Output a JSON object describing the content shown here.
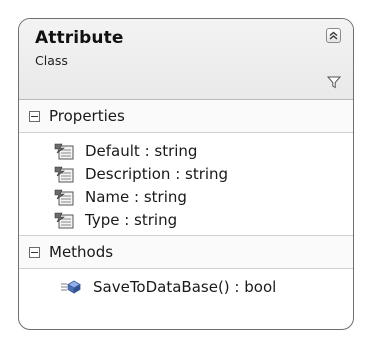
{
  "class_shape": {
    "name": "Attribute",
    "stereotype": "Class",
    "icons": {
      "collapse": "double-chevron-up-icon",
      "filter": "filter-icon"
    }
  },
  "sections": {
    "properties": {
      "label": "Properties",
      "icon": "property-icon",
      "items": [
        "Default : string",
        "Description : string",
        "Name : string",
        "Type : string"
      ]
    },
    "methods": {
      "label": "Methods",
      "icon": "method-icon",
      "items": [
        "SaveToDataBase() : bool"
      ]
    }
  },
  "colors": {
    "border": "#6f6f6f",
    "header_bg": "#efefef",
    "method_icon": "#4a6fb5"
  }
}
